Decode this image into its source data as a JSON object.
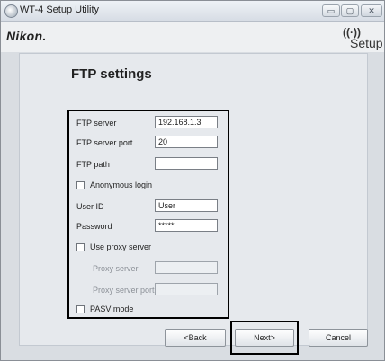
{
  "window": {
    "title": "WT-4 Setup Utility",
    "controls": {
      "minimize": "▭",
      "maximize": "▢",
      "close": "✕"
    }
  },
  "header": {
    "brand": "Nikon.",
    "setup_logo_text": "Setup"
  },
  "page": {
    "title": "FTP settings"
  },
  "form": {
    "ftp_server": {
      "label": "FTP server",
      "value": "192.168.1.3"
    },
    "ftp_server_port": {
      "label": "FTP server port",
      "value": "20"
    },
    "ftp_path": {
      "label": "FTP path",
      "value": ""
    },
    "anonymous_login": {
      "label": "Anonymous login",
      "checked": false
    },
    "user_id": {
      "label": "User ID",
      "value": "User"
    },
    "password": {
      "label": "Password",
      "value": "*****"
    },
    "use_proxy_server": {
      "label": "Use proxy server",
      "checked": false
    },
    "proxy_server": {
      "label": "Proxy server",
      "value": ""
    },
    "proxy_server_port": {
      "label": "Proxy server port",
      "value": ""
    },
    "pasv_mode": {
      "label": "PASV mode",
      "checked": false
    }
  },
  "buttons": {
    "back": "<Back",
    "next": "Next>",
    "cancel": "Cancel"
  }
}
